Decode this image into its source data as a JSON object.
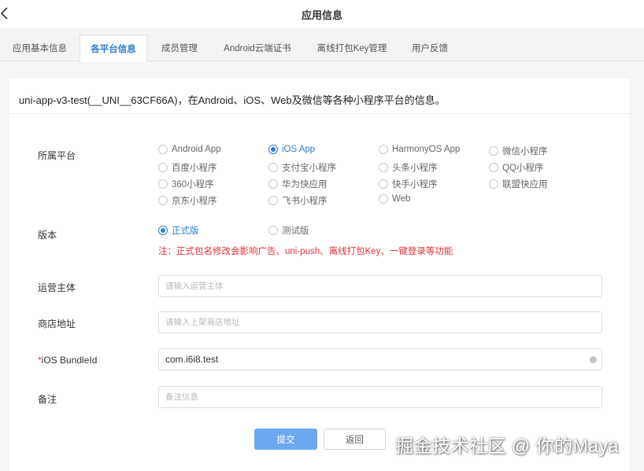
{
  "header": {
    "title": "应用信息"
  },
  "tabs": [
    {
      "label": "应用基本信息"
    },
    {
      "label": "各平台信息"
    },
    {
      "label": "成员管理"
    },
    {
      "label": "Android云端证书"
    },
    {
      "label": "离线打包Key管理"
    },
    {
      "label": "用户反馈"
    }
  ],
  "active_tab": "各平台信息",
  "description": "uni-app-v3-test(__UNI__63CF66A)，在Android、iOS、Web及微信等各种小程序平台的信息。",
  "platform": {
    "label": "所属平台",
    "selected": "iOS App",
    "options": [
      "Android App",
      "iOS App",
      "HarmonyOS App",
      "微信小程序",
      "百度小程序",
      "支付宝小程序",
      "头条小程序",
      "QQ小程序",
      "360小程序",
      "华为快应用",
      "快手小程序",
      "联盟快应用",
      "京东小程序",
      "飞书小程序",
      "Web"
    ]
  },
  "version": {
    "label": "版本",
    "selected": "正式版",
    "options": [
      "正式版",
      "测试版"
    ],
    "warning": "注：正式包名修改会影响广告、uni-push、离线打包Key、一键登录等功能"
  },
  "fields": {
    "operator": {
      "label": "运营主体",
      "placeholder": "请输入运营主体",
      "value": ""
    },
    "store_url": {
      "label": "商店地址",
      "placeholder": "请输入上架商店地址",
      "value": ""
    },
    "bundle_id": {
      "required_mark": "*",
      "label": "iOS BundleId",
      "value": "com.i6i8.test"
    },
    "remark": {
      "label": "备注",
      "placeholder": "备注信息",
      "value": ""
    }
  },
  "buttons": {
    "submit": "提交",
    "back": "返回"
  },
  "watermark": "掘金技术社区 @ 你的Maya",
  "colors": {
    "accent": "#2d7cd3",
    "warning": "#e0343a",
    "submit_bg": "#6aa8ef"
  }
}
